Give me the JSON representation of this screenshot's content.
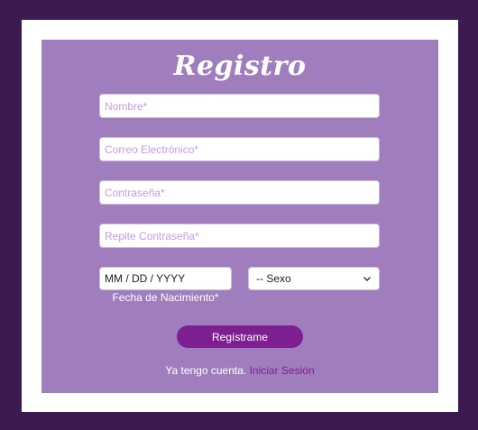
{
  "form": {
    "title": "Registro",
    "name_placeholder": "Nombre*",
    "email_placeholder": "Correo Electrónico*",
    "password_placeholder": "Contraseña*",
    "repeat_password_placeholder": "Repite Contraseña*",
    "date_value": "MM / DD / YYYY",
    "date_label": "Fecha de Nacimiento*",
    "sex_selected": "-- Sexo",
    "submit_label": "Regístrame",
    "login_prompt": "Ya tengo cuenta.",
    "login_link": "Iniciar Sesión"
  }
}
